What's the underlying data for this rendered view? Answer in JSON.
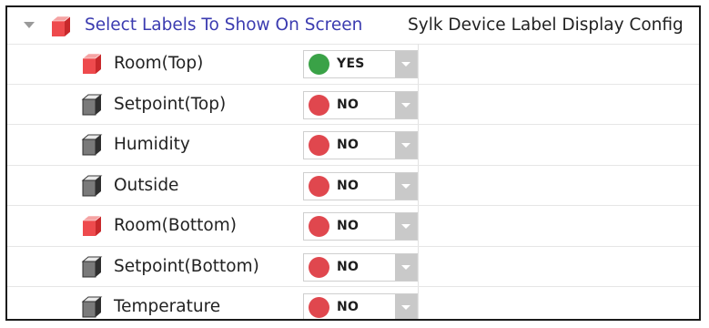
{
  "header": {
    "label": "Select Labels To Show On Screen",
    "type": "Sylk Device Label Display Config",
    "icon": "cube-red-icon",
    "expanded": true
  },
  "rows": [
    {
      "label": "Room(Top)",
      "icon": "cube-red-icon",
      "value": "YES",
      "status_color": "#3aa247"
    },
    {
      "label": "Setpoint(Top)",
      "icon": "cube-gray-icon",
      "value": "NO",
      "status_color": "#e0474e"
    },
    {
      "label": "Humidity",
      "icon": "cube-gray-icon",
      "value": "NO",
      "status_color": "#e0474e"
    },
    {
      "label": "Outside",
      "icon": "cube-gray-icon",
      "value": "NO",
      "status_color": "#e0474e"
    },
    {
      "label": "Room(Bottom)",
      "icon": "cube-red-icon",
      "value": "NO",
      "status_color": "#e0474e"
    },
    {
      "label": "Setpoint(Bottom)",
      "icon": "cube-gray-icon",
      "value": "NO",
      "status_color": "#e0474e"
    },
    {
      "label": "Temperature",
      "icon": "cube-gray-icon",
      "value": "NO",
      "status_color": "#e0474e"
    }
  ],
  "colors": {
    "header_label": "#3b3bb0",
    "yes": "#3aa247",
    "no": "#e0474e",
    "cube_red": "#e8484a",
    "cube_gray": "#555555"
  }
}
